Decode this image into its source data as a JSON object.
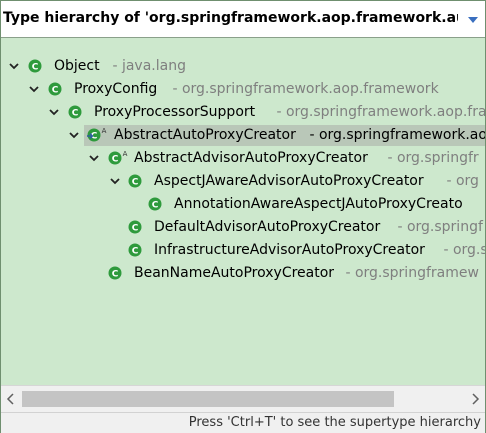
{
  "header": {
    "title": "Type hierarchy of 'org.springframework.aop.framework.auto"
  },
  "tree": [
    {
      "name": "Object",
      "package": "java.lang",
      "expanded": true,
      "icon": "class-icon"
    },
    {
      "name": "ProxyConfig",
      "package": "org.springframework.aop.framework",
      "expanded": true,
      "icon": "class-icon"
    },
    {
      "name": "ProxyProcessorSupport",
      "package": "org.springframework.aop.framework",
      "expanded": true,
      "icon": "class-icon"
    },
    {
      "name": "AbstractAutoProxyCreator",
      "package": "org.springframework.aop.framework.a",
      "expanded": true,
      "selected": true,
      "icon": "abstract-class-focus-icon"
    },
    {
      "name": "AbstractAdvisorAutoProxyCreator",
      "package": "org.springfr",
      "expanded": true,
      "icon": "abstract-class-icon"
    },
    {
      "name": "AspectJAwareAdvisorAutoProxyCreator",
      "package": "org",
      "expanded": true,
      "icon": "class-icon"
    },
    {
      "name": "AnnotationAwareAspectJAutoProxyCreato",
      "package": "",
      "icon": "class-icon"
    },
    {
      "name": "DefaultAdvisorAutoProxyCreator",
      "package": "org.springf",
      "icon": "class-icon"
    },
    {
      "name": "InfrastructureAdvisorAutoProxyCreator",
      "package": "org.s",
      "icon": "class-icon"
    },
    {
      "name": "BeanNameAutoProxyCreator",
      "package": "org.springframew",
      "icon": "class-icon"
    }
  ],
  "status": {
    "text": "Press 'Ctrl+T' to see the supertype hierarchy"
  },
  "colors": {
    "tree_bg": "#cde8cd",
    "class_icon": "#2e9a3c",
    "package_text": "#7f7f7f",
    "selection": "#b9c7b8"
  }
}
